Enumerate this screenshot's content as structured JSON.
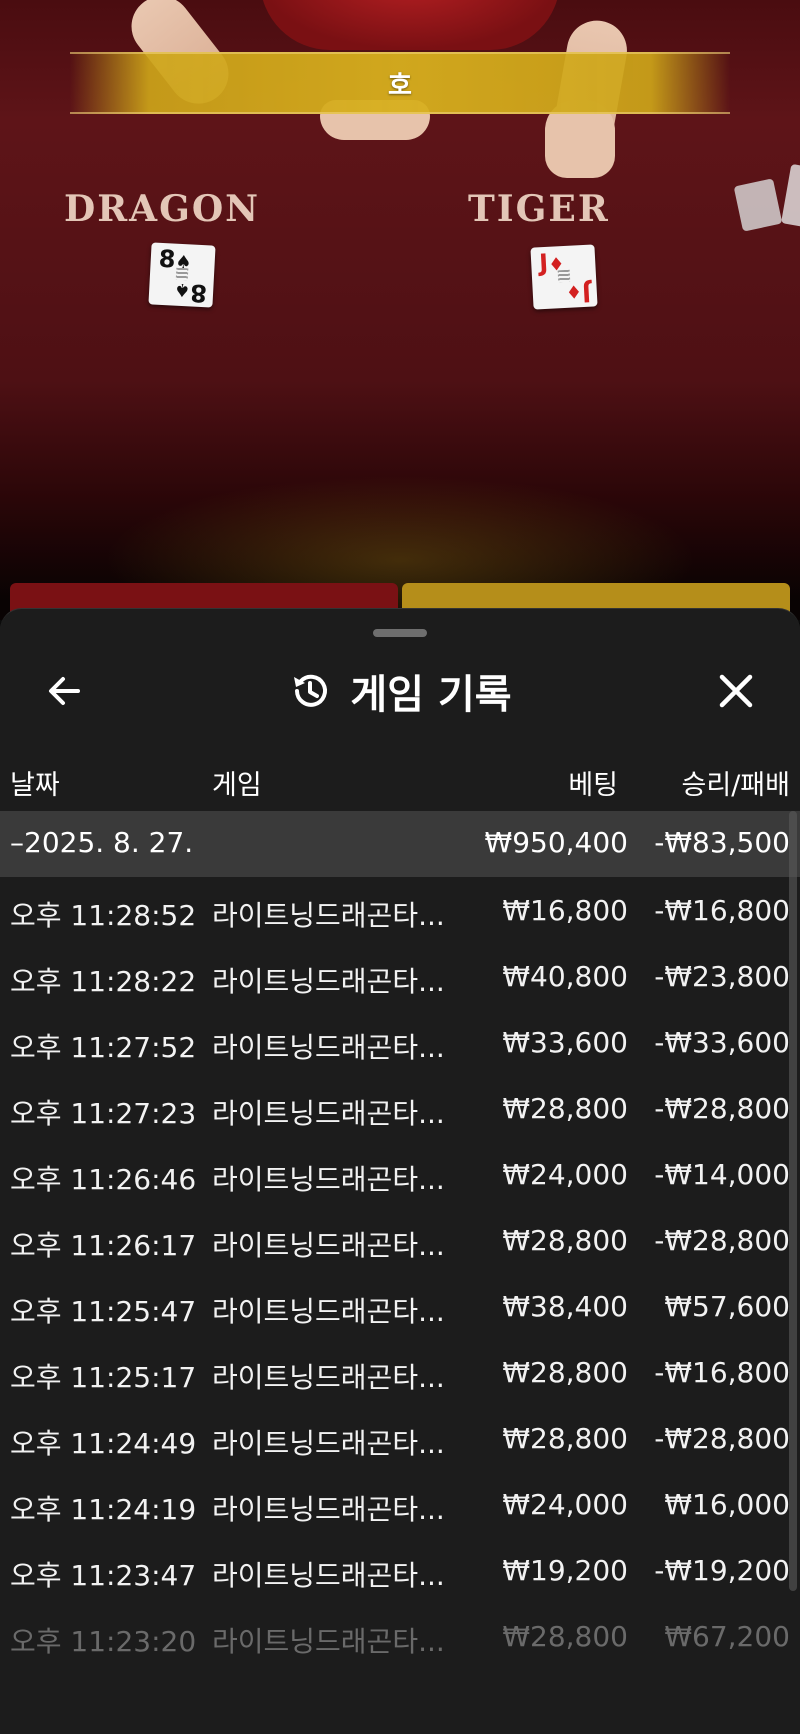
{
  "table": {
    "banner_text": "호",
    "dragon_label": "DRAGON",
    "tiger_label": "TIGER",
    "dragon_card": {
      "rank": "8",
      "suit": "♠"
    },
    "tiger_card": {
      "rank": "J",
      "suit": "♦"
    }
  },
  "sheet": {
    "title": "게임 기록",
    "icons": {
      "back": "arrow-left-icon",
      "history": "history-icon",
      "close": "close-icon"
    }
  },
  "columns": {
    "date": "날짜",
    "game": "게임",
    "bet": "베팅",
    "result": "승리/패배"
  },
  "summary": {
    "date": "–2025. 8. 27.",
    "bet": "₩950,400",
    "result": "-₩83,500"
  },
  "rows": [
    {
      "time": "오후 11:28:52",
      "game": "라이트닝드래곤타...",
      "bet": "₩16,800",
      "result": "-₩16,800"
    },
    {
      "time": "오후 11:28:22",
      "game": "라이트닝드래곤타...",
      "bet": "₩40,800",
      "result": "-₩23,800"
    },
    {
      "time": "오후 11:27:52",
      "game": "라이트닝드래곤타...",
      "bet": "₩33,600",
      "result": "-₩33,600"
    },
    {
      "time": "오후 11:27:23",
      "game": "라이트닝드래곤타...",
      "bet": "₩28,800",
      "result": "-₩28,800"
    },
    {
      "time": "오후 11:26:46",
      "game": "라이트닝드래곤타...",
      "bet": "₩24,000",
      "result": "-₩14,000"
    },
    {
      "time": "오후 11:26:17",
      "game": "라이트닝드래곤타...",
      "bet": "₩28,800",
      "result": "-₩28,800"
    },
    {
      "time": "오후 11:25:47",
      "game": "라이트닝드래곤타...",
      "bet": "₩38,400",
      "result": "₩57,600"
    },
    {
      "time": "오후 11:25:17",
      "game": "라이트닝드래곤타...",
      "bet": "₩28,800",
      "result": "-₩16,800"
    },
    {
      "time": "오후 11:24:49",
      "game": "라이트닝드래곤타...",
      "bet": "₩28,800",
      "result": "-₩28,800"
    },
    {
      "time": "오후 11:24:19",
      "game": "라이트닝드래곤타...",
      "bet": "₩24,000",
      "result": "₩16,000"
    },
    {
      "time": "오후 11:23:47",
      "game": "라이트닝드래곤타...",
      "bet": "₩19,200",
      "result": "-₩19,200"
    },
    {
      "time": "오후 11:23:20",
      "game": "라이트닝드래곤타...",
      "bet": "₩28,800",
      "result": "₩67,200"
    }
  ]
}
